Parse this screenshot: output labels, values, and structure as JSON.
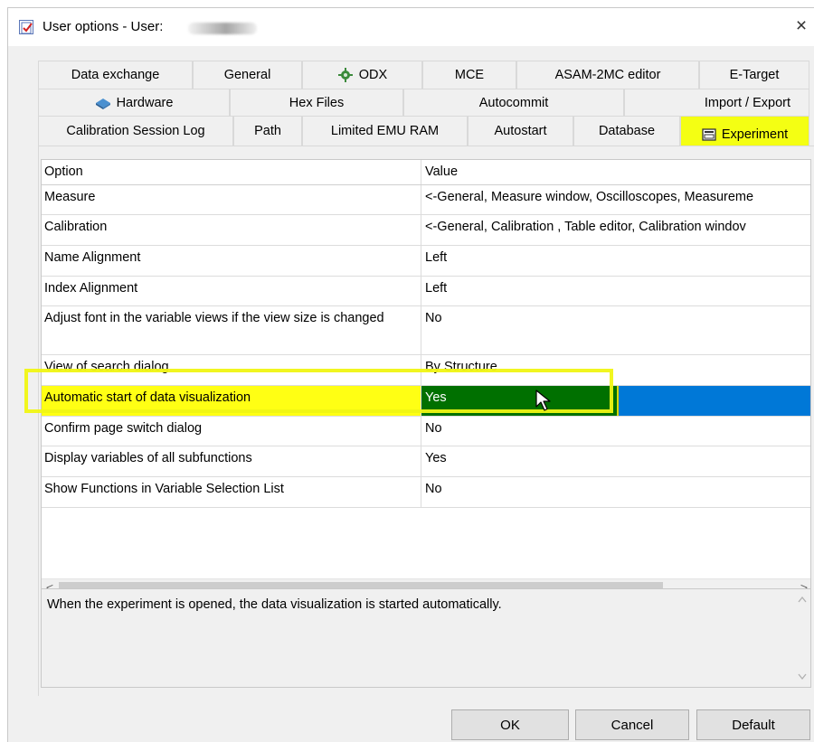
{
  "window": {
    "title": "User options - User:",
    "close_glyph": "×",
    "icon": "app-checklist-icon"
  },
  "tabs": {
    "row1": [
      {
        "label": "Data exchange"
      },
      {
        "label": "General"
      },
      {
        "label": "ODX",
        "icon": "odx-icon"
      },
      {
        "label": "MCE"
      },
      {
        "label": "ASAM-2MC editor"
      },
      {
        "label": "E-Target"
      }
    ],
    "row2": [
      {
        "label": "Hardware",
        "icon": "hardware-icon"
      },
      {
        "label": "Hex Files"
      },
      {
        "label": "Autocommit"
      },
      {
        "label": "Import / Export"
      }
    ],
    "row3": [
      {
        "label": "Calibration Session Log"
      },
      {
        "label": "Path"
      },
      {
        "label": "Limited EMU RAM"
      },
      {
        "label": "Autostart"
      },
      {
        "label": "Database"
      },
      {
        "label": "Experiment",
        "icon": "experiment-icon",
        "active": true
      }
    ]
  },
  "grid": {
    "headers": {
      "option": "Option",
      "value": "Value"
    },
    "rows": [
      {
        "option": "Measure",
        "value": "<-General, Measure window, Oscilloscopes, Measureme"
      },
      {
        "option": "Calibration",
        "value": "<-General, Calibration , Table editor, Calibration windov"
      },
      {
        "option": "Name Alignment",
        "value": "Left"
      },
      {
        "option": "Index Alignment",
        "value": "Left"
      },
      {
        "option": "Adjust font in the variable views if the view size is changed",
        "value": "No"
      },
      {
        "option": "View of search dialog",
        "value": "By Structure"
      },
      {
        "option": "Automatic start of data visualization",
        "value": "Yes",
        "selected": true
      },
      {
        "option": "Confirm page switch dialog",
        "value": "No"
      },
      {
        "option": "Display variables of all subfunctions",
        "value": "Yes"
      },
      {
        "option": "Show Functions in Variable Selection List",
        "value": "No"
      }
    ]
  },
  "scroll": {
    "left": "<",
    "right": ">",
    "up": "^",
    "down": "v"
  },
  "description": "When the experiment is opened, the data visualization is started automatically.",
  "buttons": {
    "ok": "OK",
    "cancel": "Cancel",
    "default": "Default"
  },
  "colors": {
    "highlight_yellow": "#f4ff13",
    "selection_blue": "#0078d7",
    "selection_green": "#007000"
  }
}
